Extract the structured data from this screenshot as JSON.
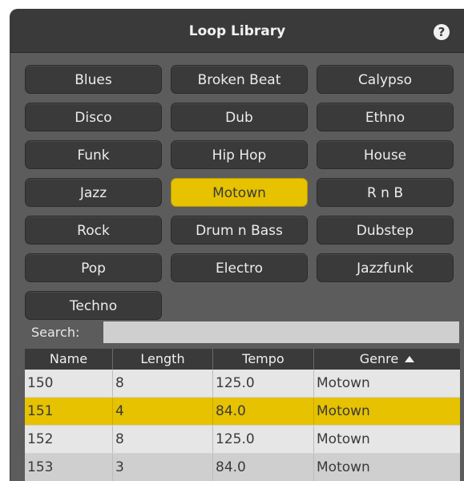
{
  "header": {
    "title": "Loop Library",
    "help_label": "?"
  },
  "genres": [
    {
      "label": "Blues",
      "selected": false
    },
    {
      "label": "Broken Beat",
      "selected": false
    },
    {
      "label": "Calypso",
      "selected": false
    },
    {
      "label": "Disco",
      "selected": false
    },
    {
      "label": "Dub",
      "selected": false
    },
    {
      "label": "Ethno",
      "selected": false
    },
    {
      "label": "Funk",
      "selected": false
    },
    {
      "label": "Hip Hop",
      "selected": false
    },
    {
      "label": "House",
      "selected": false
    },
    {
      "label": "Jazz",
      "selected": false
    },
    {
      "label": "Motown",
      "selected": true
    },
    {
      "label": "R n B",
      "selected": false
    },
    {
      "label": "Rock",
      "selected": false
    },
    {
      "label": "Drum n Bass",
      "selected": false
    },
    {
      "label": "Dubstep",
      "selected": false
    },
    {
      "label": "Pop",
      "selected": false
    },
    {
      "label": "Electro",
      "selected": false
    },
    {
      "label": "Jazzfunk",
      "selected": false
    },
    {
      "label": "Techno",
      "selected": false
    }
  ],
  "search": {
    "label": "Search:",
    "value": ""
  },
  "table": {
    "columns": [
      "Name",
      "Length",
      "Tempo",
      "Genre"
    ],
    "sort_column": "Genre",
    "sort_direction": "ascending",
    "rows": [
      {
        "name": "150",
        "length": "8",
        "tempo": "125.0",
        "genre": "Motown",
        "selected": false
      },
      {
        "name": "151",
        "length": "4",
        "tempo": "84.0",
        "genre": "Motown",
        "selected": true
      },
      {
        "name": "152",
        "length": "8",
        "tempo": "125.0",
        "genre": "Motown",
        "selected": false
      },
      {
        "name": "153",
        "length": "3",
        "tempo": "84.0",
        "genre": "Motown",
        "selected": false
      }
    ]
  },
  "colors": {
    "accent": "#e6c200",
    "panel": "#5c5c5c",
    "button": "#3a3a3a"
  }
}
